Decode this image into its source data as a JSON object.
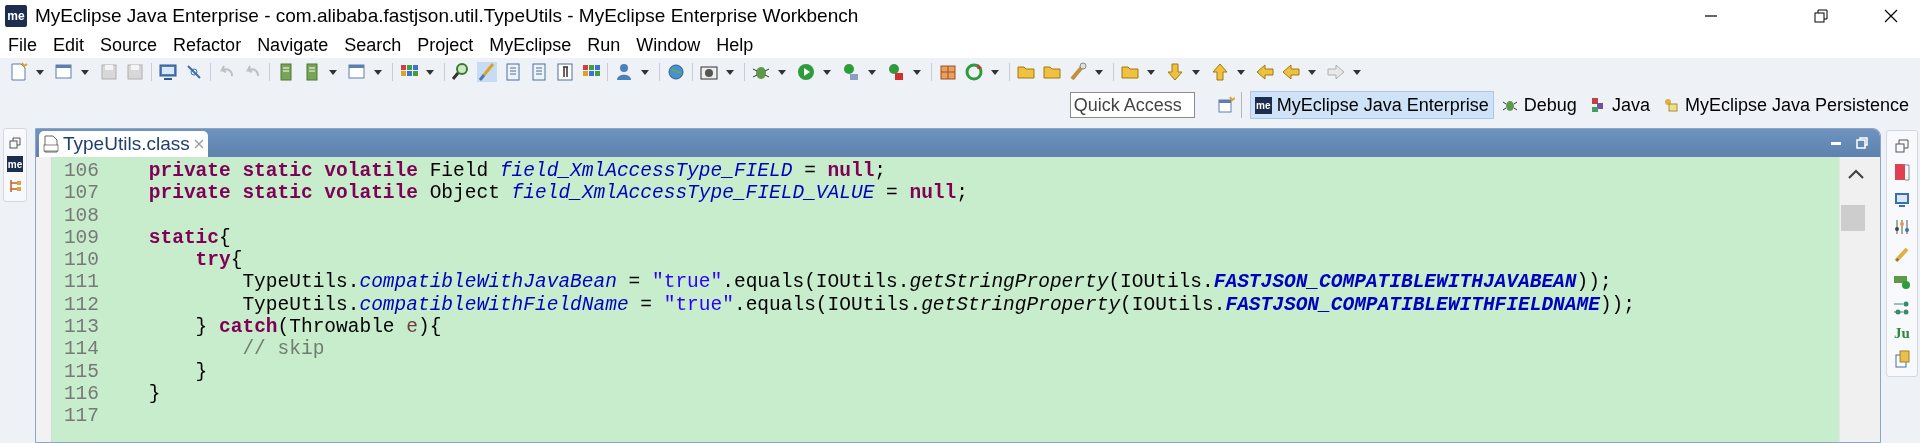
{
  "window": {
    "logo_text": "me",
    "title": "MyEclipse Java Enterprise - com.alibaba.fastjson.util.TypeUtils - MyEclipse Enterprise Workbench"
  },
  "menu": [
    {
      "label": "File"
    },
    {
      "label": "Edit"
    },
    {
      "label": "Source"
    },
    {
      "label": "Refactor"
    },
    {
      "label": "Navigate"
    },
    {
      "label": "Search"
    },
    {
      "label": "Project"
    },
    {
      "label": "MyEclipse"
    },
    {
      "label": "Run"
    },
    {
      "label": "Window"
    },
    {
      "label": "Help"
    }
  ],
  "quick_access": {
    "placeholder": "Quick Access"
  },
  "perspectives": [
    {
      "label": "MyEclipse Java Enterprise",
      "badge": "me",
      "selected": true
    },
    {
      "label": "Debug",
      "selected": false
    },
    {
      "label": "Java",
      "selected": false
    },
    {
      "label": "MyEclipse Java Persistence",
      "selected": false
    }
  ],
  "left_trim": {
    "badge": "me"
  },
  "right_trim": {
    "junit_label": "Ju"
  },
  "editor": {
    "tabs": [
      {
        "label": "TypeUtils.class",
        "selected": true
      }
    ],
    "lines": [
      {
        "number": "106",
        "tokens": [
          {
            "kind": "keyword",
            "text": "    private static volatile"
          },
          {
            "kind": "plain",
            "text": " Field "
          },
          {
            "kind": "field",
            "text": "field_XmlAccessType_FIELD"
          },
          {
            "kind": "plain",
            "text": " = "
          },
          {
            "kind": "keyword",
            "text": "null"
          },
          {
            "kind": "plain",
            "text": ";"
          }
        ]
      },
      {
        "number": "107",
        "tokens": [
          {
            "kind": "keyword",
            "text": "    private static volatile"
          },
          {
            "kind": "plain",
            "text": " Object "
          },
          {
            "kind": "field",
            "text": "field_XmlAccessType_FIELD_VALUE"
          },
          {
            "kind": "plain",
            "text": " = "
          },
          {
            "kind": "keyword",
            "text": "null"
          },
          {
            "kind": "plain",
            "text": ";"
          }
        ]
      },
      {
        "number": "108"
      },
      {
        "number": "109",
        "tokens": [
          {
            "kind": "keyword",
            "text": "    static"
          },
          {
            "kind": "plain",
            "text": "{"
          }
        ]
      },
      {
        "number": "110",
        "tokens": [
          {
            "kind": "keyword",
            "text": "        try"
          },
          {
            "kind": "plain",
            "text": "{"
          }
        ]
      },
      {
        "number": "111",
        "tokens": [
          {
            "kind": "plain",
            "text": "            TypeUtils."
          },
          {
            "kind": "field",
            "text": "compatibleWithJavaBean"
          },
          {
            "kind": "plain",
            "text": " = "
          },
          {
            "kind": "string",
            "text": "\"true\""
          },
          {
            "kind": "plain",
            "text": ".equals(IOUtils."
          },
          {
            "kind": "method",
            "text": "getStringProperty"
          },
          {
            "kind": "plain",
            "text": "(IOUtils."
          },
          {
            "kind": "constant",
            "text": "FASTJSON_COMPATIBLEWITHJAVABEAN"
          },
          {
            "kind": "plain",
            "text": "));"
          }
        ]
      },
      {
        "number": "112",
        "tokens": [
          {
            "kind": "plain",
            "text": "            TypeUtils."
          },
          {
            "kind": "field",
            "text": "compatibleWithFieldName"
          },
          {
            "kind": "plain",
            "text": " = "
          },
          {
            "kind": "string",
            "text": "\"true\""
          },
          {
            "kind": "plain",
            "text": ".equals(IOUtils."
          },
          {
            "kind": "method",
            "text": "getStringProperty"
          },
          {
            "kind": "plain",
            "text": "(IOUtils."
          },
          {
            "kind": "constant",
            "text": "FASTJSON_COMPATIBLEWITHFIELDNAME"
          },
          {
            "kind": "plain",
            "text": "));"
          }
        ]
      },
      {
        "number": "113",
        "tokens": [
          {
            "kind": "plain",
            "text": "        } "
          },
          {
            "kind": "keyword",
            "text": "catch"
          },
          {
            "kind": "plain",
            "text": "(Throwable "
          },
          {
            "kind": "local",
            "text": "e"
          },
          {
            "kind": "plain",
            "text": "){"
          }
        ]
      },
      {
        "number": "114",
        "tokens": [
          {
            "kind": "comment",
            "text": "            // skip"
          }
        ]
      },
      {
        "number": "115",
        "tokens": [
          {
            "kind": "plain",
            "text": "        }"
          }
        ]
      },
      {
        "number": "116",
        "tokens": [
          {
            "kind": "plain",
            "text": "    }"
          }
        ]
      },
      {
        "number": "117"
      }
    ]
  }
}
